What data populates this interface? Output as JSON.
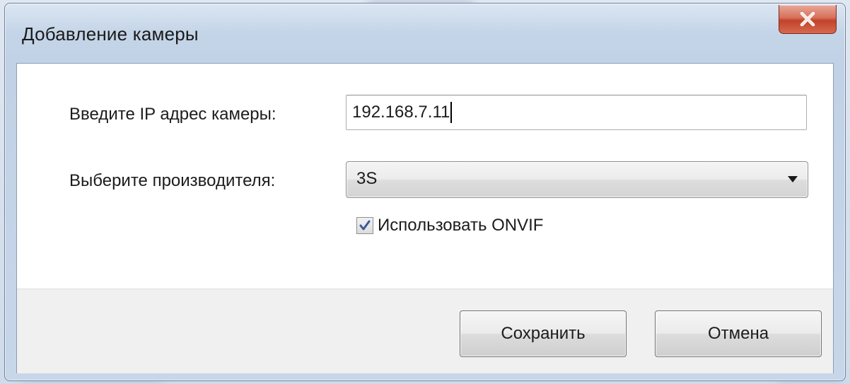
{
  "window": {
    "title": "Добавление камеры"
  },
  "form": {
    "ip_label": "Введите IP адрес камеры:",
    "ip_value": "192.168.7.11",
    "vendor_label": "Выберите производителя:",
    "vendor_value": "3S",
    "onvif_label": "Использовать ONVIF",
    "onvif_checked": true
  },
  "buttons": {
    "save_label": "Сохранить",
    "cancel_label": "Отмена"
  },
  "icons": {
    "close": "close-icon",
    "dropdown": "chevron-down-icon",
    "checkmark": "checkmark-icon"
  },
  "colors": {
    "close_button": "#c2432a",
    "frame": "#c5d5e8",
    "checkmark": "#3c5a9a"
  }
}
